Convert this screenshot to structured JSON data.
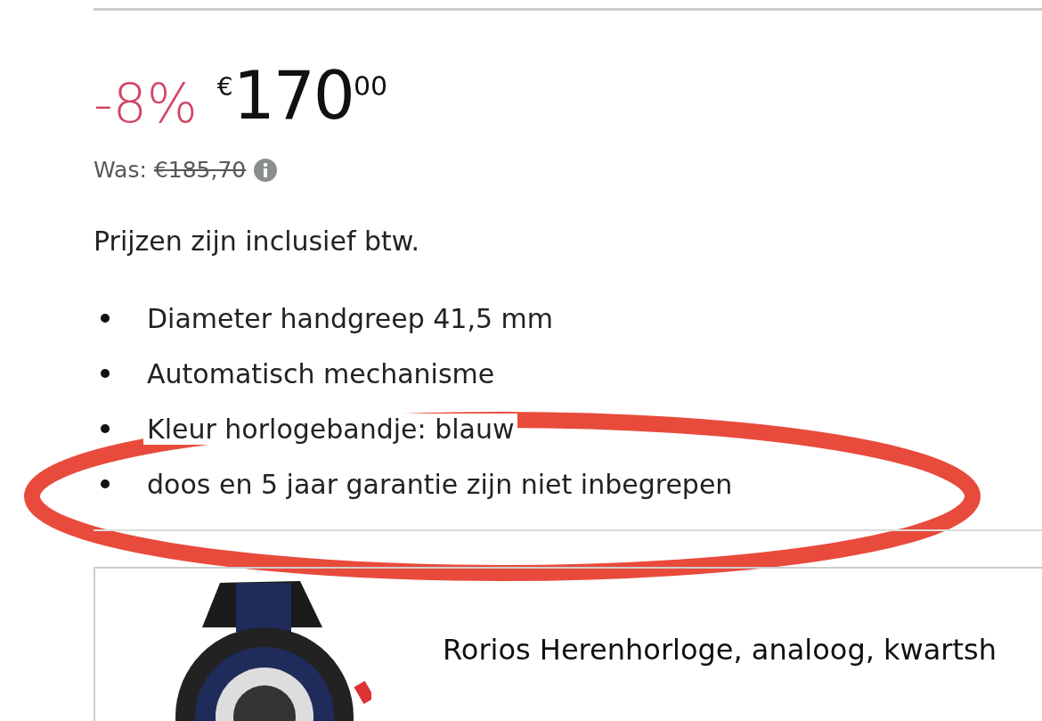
{
  "price": {
    "discount": "-8%",
    "currency": "€",
    "whole": "170",
    "fraction": "00",
    "was_label": "Was:",
    "was_price": "€185,70"
  },
  "tax_note": "Prijzen zijn inclusief btw.",
  "bullets": [
    "Diameter handgreep 41,5 mm",
    "Automatisch mechanisme",
    "Kleur horlogebandje: blauw",
    "doos en 5 jaar garantie zijn niet inbegrepen"
  ],
  "product_card": {
    "title": "Rorios Herenhorloge, analoog, kwartsh"
  }
}
